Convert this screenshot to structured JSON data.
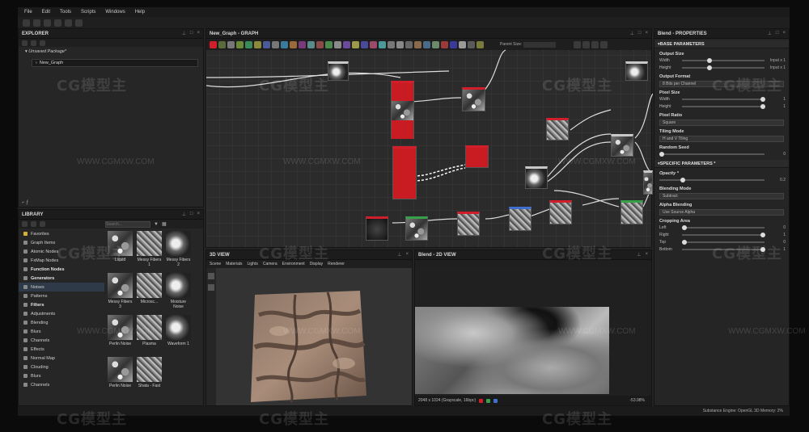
{
  "menu": [
    "File",
    "Edit",
    "Tools",
    "Scripts",
    "Windows",
    "Help"
  ],
  "explorer": {
    "title": "EXPLORER",
    "package": "Unsaved Package*",
    "graph": "New_Graph"
  },
  "graph_panel": {
    "title": "New_Graph - GRAPH",
    "parent_size_label": "Parent Size:"
  },
  "library": {
    "title": "LIBRARY",
    "search_placeholder": "Search...",
    "tree": [
      {
        "label": "Favorites",
        "hdr": false
      },
      {
        "label": "Graph Items",
        "hdr": false
      },
      {
        "label": "Atomic Nodes",
        "hdr": false
      },
      {
        "label": "FxMap Nodes",
        "hdr": false
      },
      {
        "label": "Function Nodes",
        "hdr": true
      },
      {
        "label": "Generators",
        "hdr": true
      },
      {
        "label": "Noises",
        "hdr": false,
        "sel": true
      },
      {
        "label": "Patterns",
        "hdr": false
      },
      {
        "label": "Filters",
        "hdr": true
      },
      {
        "label": "Adjustments",
        "hdr": false
      },
      {
        "label": "Blending",
        "hdr": false
      },
      {
        "label": "Blurs",
        "hdr": false
      },
      {
        "label": "Channels",
        "hdr": false
      },
      {
        "label": "Effects",
        "hdr": false
      },
      {
        "label": "Normal Map",
        "hdr": false
      },
      {
        "label": "Clouding",
        "hdr": false
      },
      {
        "label": "Blurs",
        "hdr": false
      },
      {
        "label": "Channels",
        "hdr": false
      }
    ],
    "thumbs": [
      {
        "label": "Liquid"
      },
      {
        "label": "Messy Fibers 1"
      },
      {
        "label": "Messy Fibers 2"
      },
      {
        "label": "Messy Fibers 3"
      },
      {
        "label": "Microsc..."
      },
      {
        "label": "Moisture Noise"
      },
      {
        "label": "Perlin Noise"
      },
      {
        "label": "Plasma"
      },
      {
        "label": "Waveform 1"
      },
      {
        "label": "Perlin Noise"
      },
      {
        "label": "Shata - Fast"
      }
    ]
  },
  "view3d": {
    "title": "3D VIEW",
    "menu": [
      "Scene",
      "Materials",
      "Lights",
      "Camera",
      "Environment",
      "Display",
      "Renderer"
    ]
  },
  "view2d": {
    "title": "Blend - 2D VIEW",
    "status": "2048 x 1024 (Grayscale, 16bpc)",
    "zoom": "-53.98%"
  },
  "properties": {
    "title": "Blend - PROPERTIES",
    "base": "BASE PARAMETERS",
    "output_size": "Output Size",
    "width": "Width",
    "height": "Height",
    "input_x1": "Input x 1",
    "output_format": "Output Format",
    "output_format_value": "8 Bits per Channel",
    "pixel_size": "Pixel Size",
    "pixel_ratio": "Pixel Ratio",
    "pixel_ratio_value": "Square",
    "tiling_mode": "Tiling Mode",
    "tiling_value": "H and V Tiling",
    "random_seed": "Random Seed",
    "specific": "SPECIFIC PARAMETERS *",
    "opacity": "Opacity *",
    "opacity_value": "0.2",
    "blending_mode": "Blending Mode",
    "blending_value": "Subtract",
    "alpha_blending": "Alpha Blending",
    "alpha_value": "Use Source Alpha",
    "cropping": "Cropping Area",
    "left": "Left",
    "right": "Right",
    "top": "Top",
    "bottom": "Bottom",
    "zero": "0",
    "one": "1"
  },
  "statusbar": "Substance Engine: OpenGL 3D  Memory: 2%",
  "watermark": {
    "logo": "CG模型主",
    "url": "WWW.CGMXW.COM"
  },
  "colors": {
    "accent": "#d01e2a",
    "selection": "#2f3a48"
  }
}
